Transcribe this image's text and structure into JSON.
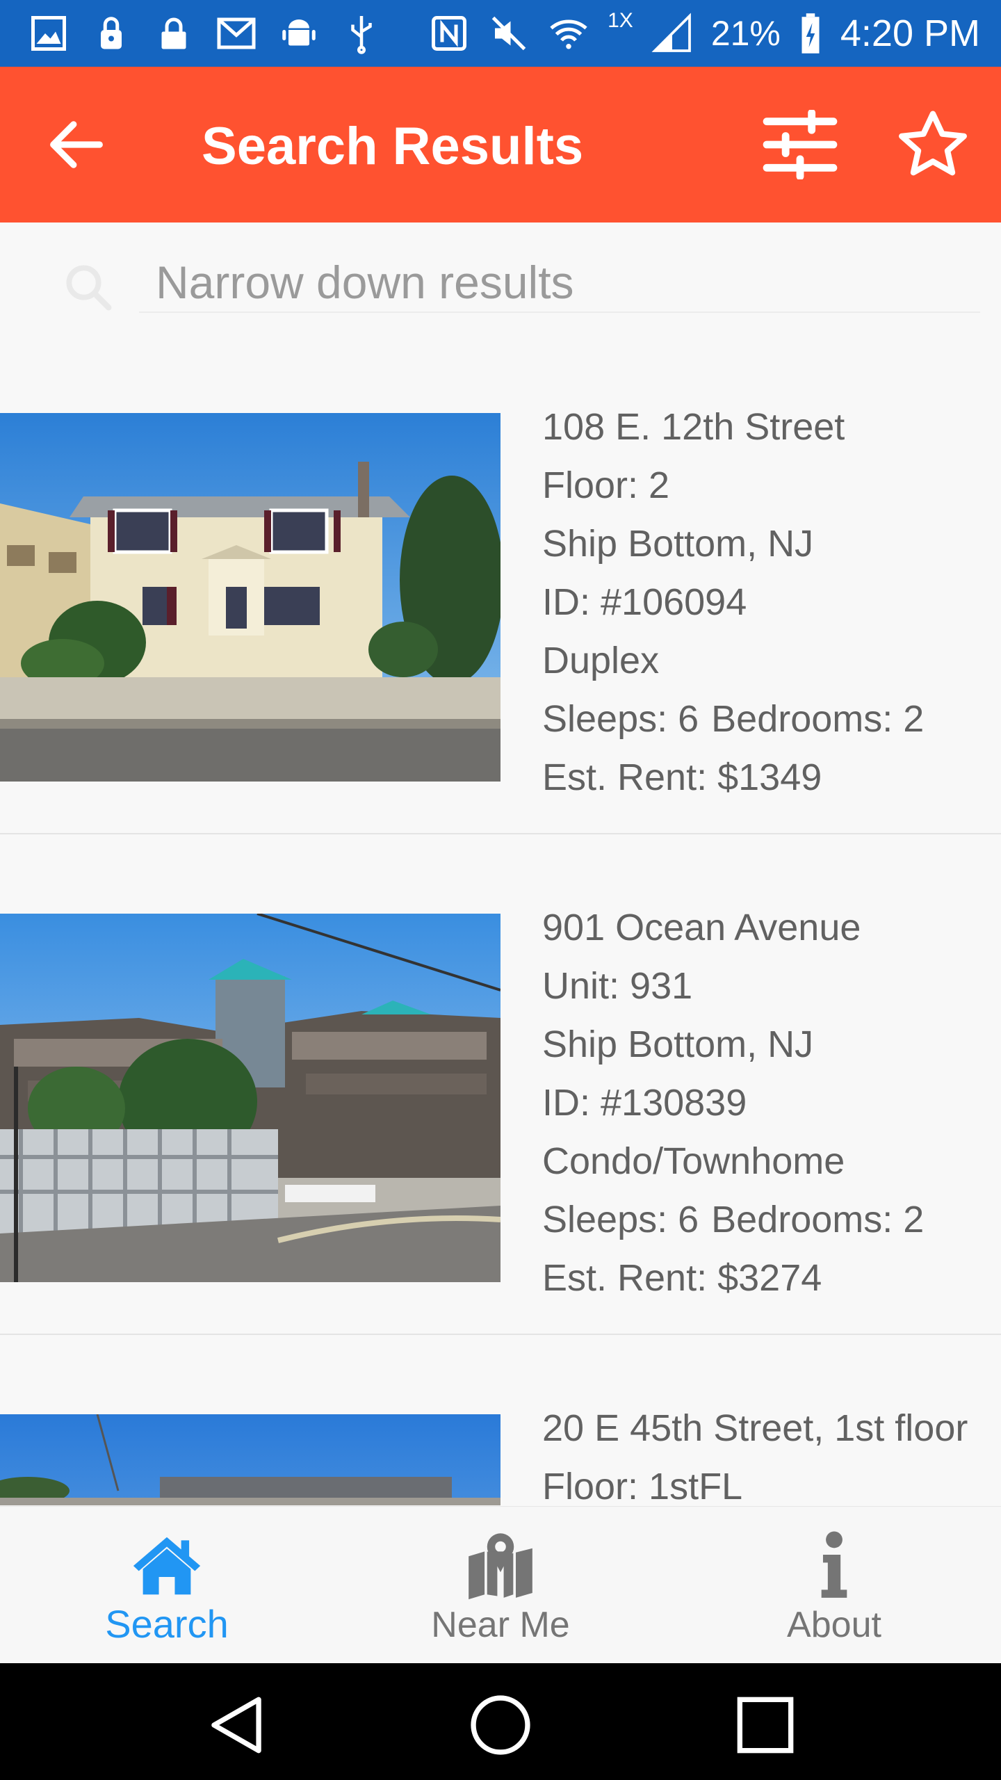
{
  "status_bar": {
    "battery_percent": "21%",
    "time": "4:20 PM",
    "network_label": "1X",
    "left_icons": [
      "gallery-icon",
      "lock-icon",
      "lock-icon",
      "gmail-icon",
      "android-icon",
      "usb-icon"
    ],
    "right_icons": [
      "nfc-icon",
      "mute-icon",
      "wifi-icon",
      "signal-icon",
      "battery-charging-icon"
    ]
  },
  "app_bar": {
    "title": "Search Results",
    "back_icon": "arrow-left-icon",
    "filter_icon": "sliders-icon",
    "favorite_icon": "star-outline-icon"
  },
  "search": {
    "placeholder": "Narrow down results",
    "value": ""
  },
  "results": [
    {
      "address": "108 E. 12th Street",
      "unit": "Floor: 2",
      "city": "Ship Bottom, NJ",
      "id": "ID: #106094",
      "type": "Duplex",
      "sleeps": "Sleeps: 6",
      "bedrooms": "Bedrooms: 2",
      "rent": "Est. Rent: $1349"
    },
    {
      "address": "901 Ocean Avenue",
      "unit": "Unit: 931",
      "city": "Ship Bottom, NJ",
      "id": "ID: #130839",
      "type": "Condo/Townhome",
      "sleeps": "Sleeps: 6",
      "bedrooms": "Bedrooms: 2",
      "rent": "Est. Rent: $3274"
    },
    {
      "address": "20 E 45th Street, 1st floor",
      "unit": "Floor: 1stFL"
    }
  ],
  "bottom_nav": {
    "items": [
      {
        "label": "Search",
        "icon": "home-icon",
        "active": true
      },
      {
        "label": "Near Me",
        "icon": "map-marker-icon",
        "active": false
      },
      {
        "label": "About",
        "icon": "info-icon",
        "active": false
      }
    ]
  },
  "colors": {
    "status_bar": "#1565c0",
    "app_bar": "#ff5230",
    "active_tab": "#2196f3",
    "inactive_tab": "#757575",
    "text": "#616161"
  }
}
